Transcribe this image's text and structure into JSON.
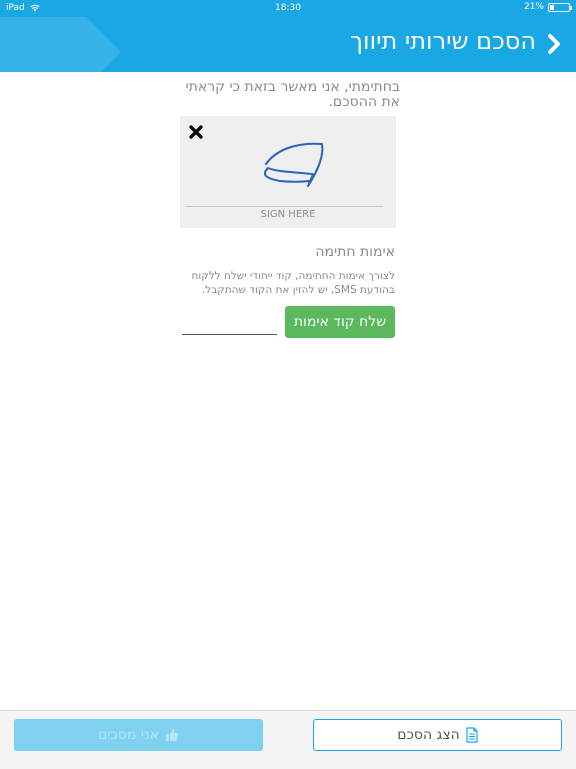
{
  "status_bar": {
    "device": "iPad",
    "time": "18:30",
    "battery_text": "21%",
    "battery_level": 0.21,
    "wifi_icon": "wifi-icon"
  },
  "header": {
    "title": "הסכם שירותי תיווך",
    "back_icon": "chevron-right-icon",
    "color": "#1aa8e4"
  },
  "agreement": {
    "text": "בחתימתי, אני מאשר בזאת כי קראתי את ההסכם."
  },
  "signature": {
    "label": "SIGN HERE",
    "clear_icon": "close-icon"
  },
  "verification": {
    "title": "אימות חתימה",
    "description": "לצורך אימות החתימה, קוד ייחודי ישלח ללקוח בהודעת SMS, יש להזין את הקוד שהתקבל.",
    "code_value": "",
    "send_button": "שלח קוד אימות",
    "button_color": "#5cb85c"
  },
  "footer": {
    "agree_button": "אני מסכים",
    "agree_icon": "thumbs-up-icon",
    "show_button": "הצג הסכם",
    "show_icon": "document-icon"
  }
}
